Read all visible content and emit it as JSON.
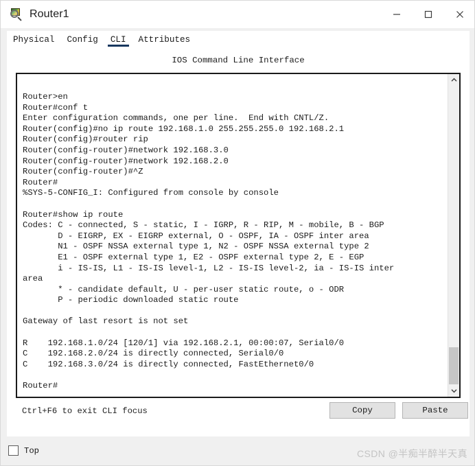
{
  "window": {
    "title": "Router1",
    "icon": "packet-tracer-device-icon",
    "controls": {
      "minimize": "minimize-icon",
      "maximize": "maximize-icon",
      "close": "close-icon"
    }
  },
  "tabs": [
    {
      "label": "Physical",
      "active": false
    },
    {
      "label": "Config",
      "active": false
    },
    {
      "label": "CLI",
      "active": true
    },
    {
      "label": "Attributes",
      "active": false
    }
  ],
  "panel": {
    "heading": "IOS Command Line Interface"
  },
  "terminal": {
    "text": "Router>en\nRouter#conf t\nEnter configuration commands, one per line.  End with CNTL/Z.\nRouter(config)#no ip route 192.168.1.0 255.255.255.0 192.168.2.1\nRouter(config)#router rip\nRouter(config-router)#network 192.168.3.0\nRouter(config-router)#network 192.168.2.0\nRouter(config-router)#^Z\nRouter#\n%SYS-5-CONFIG_I: Configured from console by console\n\nRouter#show ip route\nCodes: C - connected, S - static, I - IGRP, R - RIP, M - mobile, B - BGP\n       D - EIGRP, EX - EIGRP external, O - OSPF, IA - OSPF inter area\n       N1 - OSPF NSSA external type 1, N2 - OSPF NSSA external type 2\n       E1 - OSPF external type 1, E2 - OSPF external type 2, E - EGP\n       i - IS-IS, L1 - IS-IS level-1, L2 - IS-IS level-2, ia - IS-IS inter\narea\n       * - candidate default, U - per-user static route, o - ODR\n       P - periodic downloaded static route\n\nGateway of last resort is not set\n\nR    192.168.1.0/24 [120/1] via 192.168.2.1, 00:00:07, Serial0/0\nC    192.168.2.0/24 is directly connected, Serial0/0\nC    192.168.3.0/24 is directly connected, FastEthernet0/0\n\nRouter#",
    "scrollbar": {
      "up_arrow": "chevron-up-icon",
      "down_arrow": "chevron-down-icon"
    }
  },
  "footer": {
    "hint": "Ctrl+F6 to exit CLI focus",
    "copy_label": "Copy",
    "paste_label": "Paste"
  },
  "bottom": {
    "top_checkbox_label": "Top",
    "top_checkbox_checked": false,
    "watermark": "CSDN @半痴半醉半天真"
  },
  "colors": {
    "accent": "#17375e",
    "panel_bg": "#ffffff",
    "window_bg": "#f0f0f0",
    "terminal_text": "#1b1b1b",
    "button_bg": "#e2e2e2",
    "scrollbar_thumb": "#c6c6c6",
    "watermark": "#c4c4c4"
  }
}
